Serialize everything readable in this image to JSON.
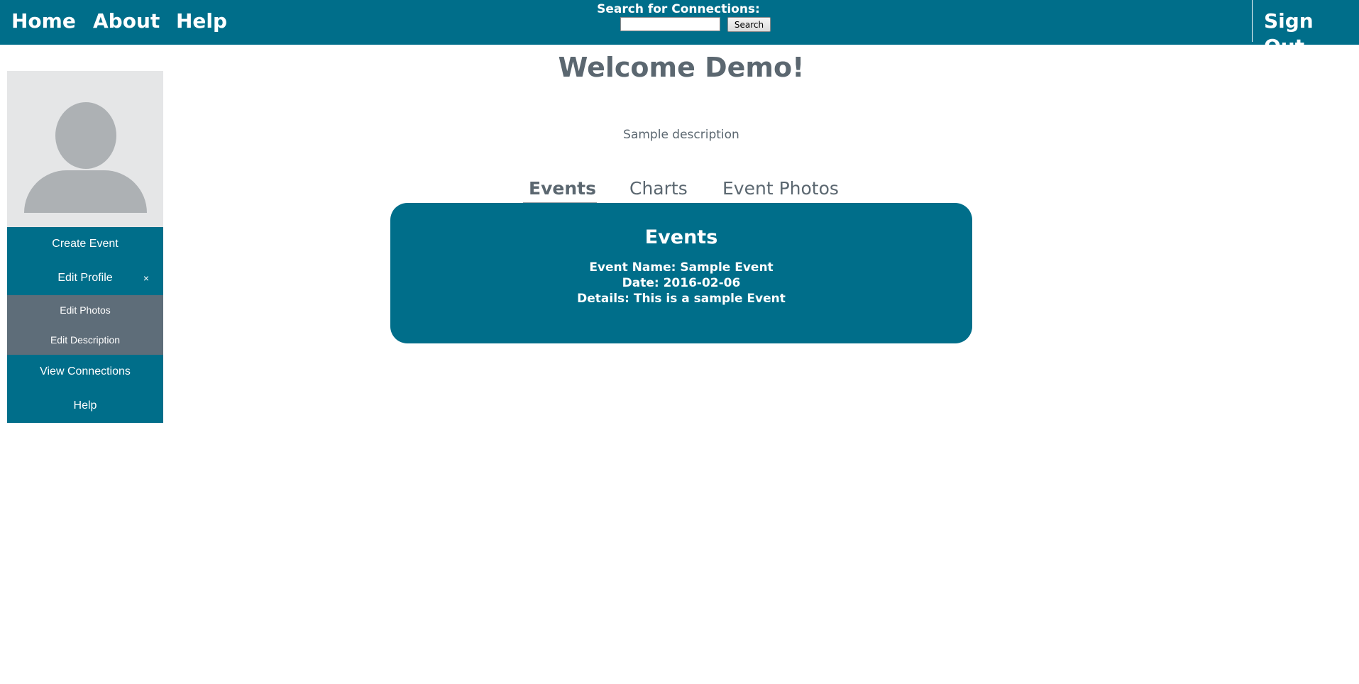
{
  "nav": {
    "home": "Home",
    "about": "About",
    "help": "Help",
    "sign_out": "Sign Out"
  },
  "search": {
    "label": "Search for Connections:",
    "value": "",
    "button": "Search"
  },
  "sidebar": {
    "avatar_icon": "user-silhouette-icon",
    "items": {
      "create_event": "Create Event",
      "edit_profile": "Edit Profile",
      "edit_profile_close": "×",
      "edit_photos": "Edit Photos",
      "edit_description": "Edit Description",
      "view_connections": "View Connections",
      "help": "Help"
    }
  },
  "main": {
    "welcome": "Welcome Demo!",
    "description": "Sample description",
    "tabs": {
      "events": "Events",
      "charts": "Charts",
      "event_photos": "Event Photos"
    },
    "active_tab": "Events",
    "panel": {
      "title": "Events",
      "event_name": "Event Name: Sample Event",
      "date": "Date: 2016-02-06",
      "details": "Details: This is a sample Event"
    }
  },
  "colors": {
    "primary": "#006e8a",
    "submenu": "#5e6d79",
    "text_muted": "#5b6770",
    "avatar_bg": "#e5e6e7",
    "avatar_fg": "#adb1b4"
  }
}
